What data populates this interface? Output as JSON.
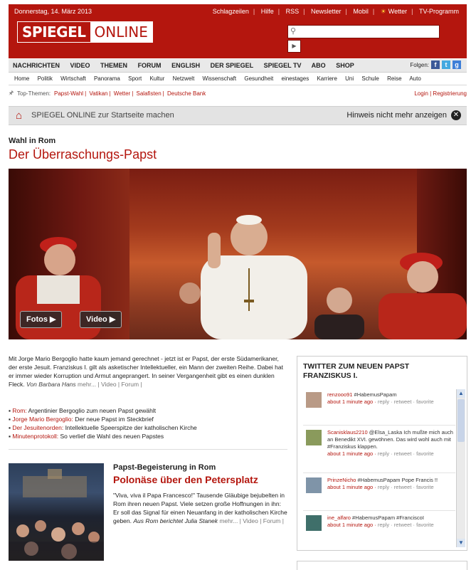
{
  "header": {
    "date": "Donnerstag, 14. März 2013",
    "toplinks": [
      "Schlagzeilen",
      "Hilfe",
      "RSS",
      "Newsletter",
      "Mobil"
    ],
    "weather": "Wetter",
    "tvprogram": "TV-Programm",
    "logo_left": "SPIEGEL",
    "logo_right": "ONLINE"
  },
  "nav_main": [
    "NACHRICHTEN",
    "VIDEO",
    "THEMEN",
    "FORUM",
    "ENGLISH",
    "DER SPIEGEL",
    "SPIEGEL TV",
    "ABO",
    "SHOP"
  ],
  "follow_label": "Folgen:",
  "nav_sub": [
    "Home",
    "Politik",
    "Wirtschaft",
    "Panorama",
    "Sport",
    "Kultur",
    "Netzwelt",
    "Wissenschaft",
    "Gesundheit",
    "einestages",
    "Karriere",
    "Uni",
    "Schule",
    "Reise",
    "Auto"
  ],
  "top_themes": {
    "label": "Top-Themen:",
    "items": [
      "Papst-Wahl",
      "Vatikan",
      "Wetter",
      "Salafisten",
      "Deutsche Bank"
    ],
    "login": "Login",
    "register": "Registrierung"
  },
  "banner": {
    "text": "SPIEGEL ONLINE zur Startseite machen",
    "hide": "Hinweis nicht mehr anzeigen"
  },
  "lead": {
    "kicker": "Wahl in Rom",
    "title": "Der Überraschungs-Papst",
    "btn_photos": "Fotos",
    "btn_video": "Video",
    "intro": "Mit Jorge Mario Bergoglio hatte kaum jemand gerechnet - jetzt ist er Papst, der erste Südamerikaner, der erste Jesuit. Franziskus I. gilt als asketischer Intellektueller, ein Mann der zweiten Reihe. Dabei hat er immer wieder Korruption und Armut angeprangert. In seiner Vergangenheit gibt es einen dunklen Fleck.",
    "author": "Von Barbara Hans",
    "meta": "mehr... | Video | Forum |",
    "bullets": [
      {
        "b": "Rom:",
        "t": " Argentinier Bergoglio zum neuen Papst gewählt"
      },
      {
        "b": "Jorge Mario Bergoglio:",
        "t": " Der neue Papst im Steckbrief"
      },
      {
        "b": "Der Jesuitenorden:",
        "t": " Intellektuelle Speerspitze der katholischen Kirche"
      },
      {
        "b": "Minutenprotokoll:",
        "t": " So verlief die Wahl des neuen Papstes"
      }
    ]
  },
  "second": {
    "kicker": "Papst-Begeisterung in Rom",
    "title": "Polonäse über den Petersplatz",
    "body": "\"Viva, viva il Papa Francesco!\" Tausende Gläubige bejubelten in Rom ihren neuen Papst. Viele setzen große Hoffnungen in ihn: Er soll das Signal für einen Neuanfang in der katholischen Kirche geben.",
    "author": "Aus Rom berichtet Julia Stanek",
    "meta": "mehr... | Video | Forum |"
  },
  "twitter": {
    "title_line1": "TWITTER ZUM NEUEN PAPST",
    "title_line2": "FRANZISKUS I.",
    "tweets": [
      {
        "user": "renzooo91",
        "text": " #HabemusPapam",
        "time": "about 1 minute ago",
        "actions": "reply · retweet · favorite"
      },
      {
        "user": "Scanisklaus2210",
        "text": " @Elsa_Laska Ich mußte mich auch an Benedikt XVI. gewöhnen. Das wird wohl auch mit #Franziskus klappen.",
        "time": "about 1 minute ago",
        "actions": "reply · retweet · favorite"
      },
      {
        "user": "PrinzeNicho",
        "text": " #HabemusPapam Pope Francis !!",
        "time": "about 1 minute ago",
        "actions": "reply · retweet · favorite"
      },
      {
        "user": "ine_alfaro",
        "text": " #HabemusPapam #FranciscoI",
        "time": "about 1 minute ago",
        "actions": "reply · retweet · favorite"
      }
    ]
  },
  "colors": {
    "brand": "#b4160e",
    "nav_bg": "#e9e9e9",
    "banner_bg": "#e3e3e3"
  }
}
